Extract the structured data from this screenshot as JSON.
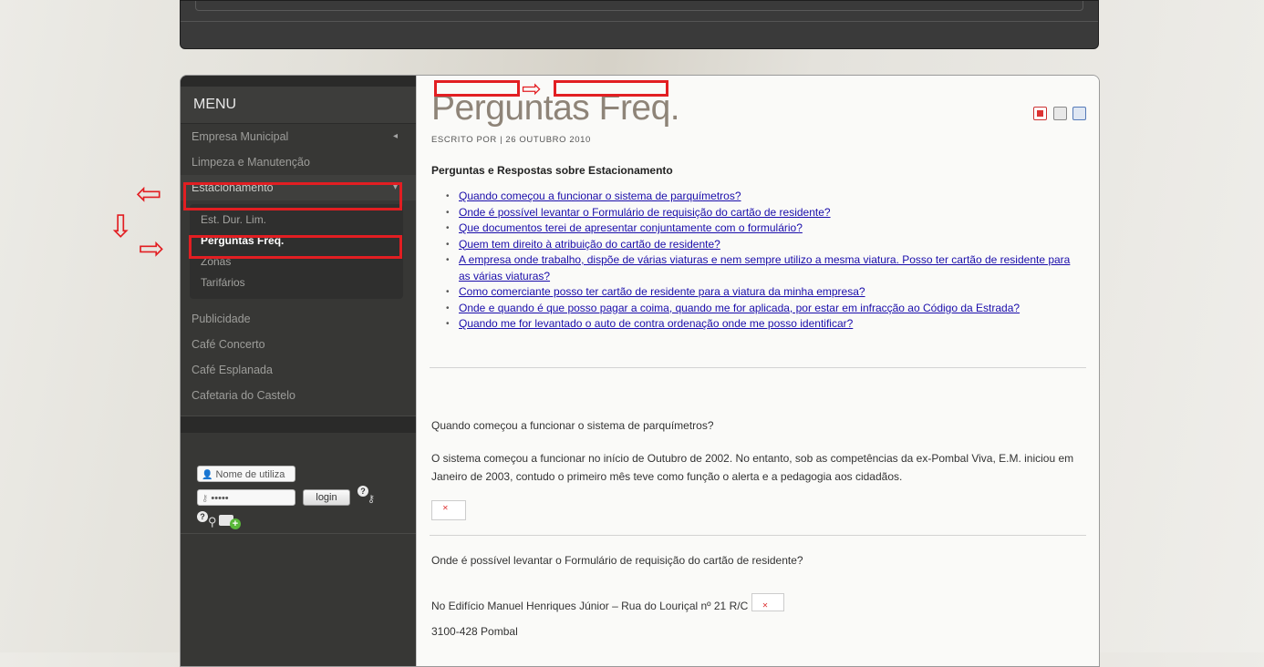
{
  "sidebar": {
    "menu_title": "MENU",
    "items": [
      {
        "label": "Empresa Municipal",
        "chevron": "◂"
      },
      {
        "label": "Limpeza e Manutenção"
      },
      {
        "label": "Estacionamento",
        "chevron": "▾"
      },
      {
        "label": "Publicidade"
      },
      {
        "label": "Café Concerto"
      },
      {
        "label": "Café Esplanada"
      },
      {
        "label": "Cafetaria do Castelo"
      }
    ],
    "submenu": [
      {
        "label": "Est. Dur. Lim."
      },
      {
        "label": "Perguntas Freq."
      },
      {
        "label": "Zonas"
      },
      {
        "label": "Tarifários"
      }
    ]
  },
  "login": {
    "username_placeholder": "Nome de utiliza",
    "password_value": "•••••",
    "login_label": "login"
  },
  "content": {
    "title": "Perguntas Freq.",
    "byline": "ESCRITO POR | 26 OUTUBRO 2010",
    "section_heading": "Perguntas e Respostas sobre Estacionamento",
    "faq": [
      "Quando começou a funcionar o sistema de parquímetros?",
      "Onde é possível levantar o Formulário de requisição do cartão de residente?",
      "Que documentos terei de apresentar conjuntamente com o formulário?",
      "Quem tem direito à atribuição do cartão de residente?",
      "A empresa onde trabalho, dispõe de várias viaturas e nem sempre utilizo a mesma viatura. Posso ter cartão de residente para as várias viaturas?",
      "Como comerciante posso ter cartão de residente para a viatura da minha empresa?",
      "Onde e quando é que posso pagar a coima, quando me for aplicada, por estar em infracção ao Código da Estrada?",
      "Quando me for levantado o auto de contra ordenação onde me posso identificar?"
    ],
    "q1": "Quando começou a funcionar o sistema de parquímetros?",
    "a1": "O sistema começou a funcionar no início de Outubro de 2002. No entanto, sob as competências da ex-Pombal Viva, E.M. iniciou em Janeiro de 2003, contudo o primeiro mês teve como função o alerta e a pedagogia aos cidadãos.",
    "q2": "Onde é possível levantar o Formulário de requisição do cartão de residente?",
    "a2_line1": "No Edifício Manuel Henriques Júnior – Rua do Louriçal nº 21 R/C",
    "a2_line2": "3100-428 Pombal"
  },
  "icons": {
    "pdf": "pdf-icon",
    "print": "print-icon",
    "email": "email-icon",
    "user": "user-icon",
    "key": "key-icon",
    "help": "help-icon",
    "add_user": "add-user-icon"
  },
  "annotation_color": "#e21e22"
}
